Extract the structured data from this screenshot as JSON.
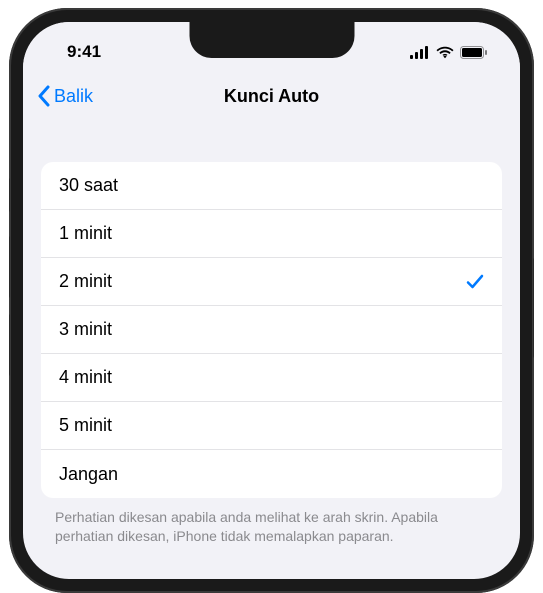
{
  "status_bar": {
    "time": "9:41"
  },
  "nav": {
    "back_label": "Balik",
    "title": "Kunci Auto"
  },
  "options": [
    {
      "label": "30 saat",
      "selected": false
    },
    {
      "label": "1 minit",
      "selected": false
    },
    {
      "label": "2 minit",
      "selected": true
    },
    {
      "label": "3 minit",
      "selected": false
    },
    {
      "label": "4 minit",
      "selected": false
    },
    {
      "label": "5 minit",
      "selected": false
    },
    {
      "label": "Jangan",
      "selected": false
    }
  ],
  "footer_text": "Perhatian dikesan apabila anda melihat ke arah skrin. Apabila perhatian dikesan, iPhone tidak memalapkan paparan."
}
